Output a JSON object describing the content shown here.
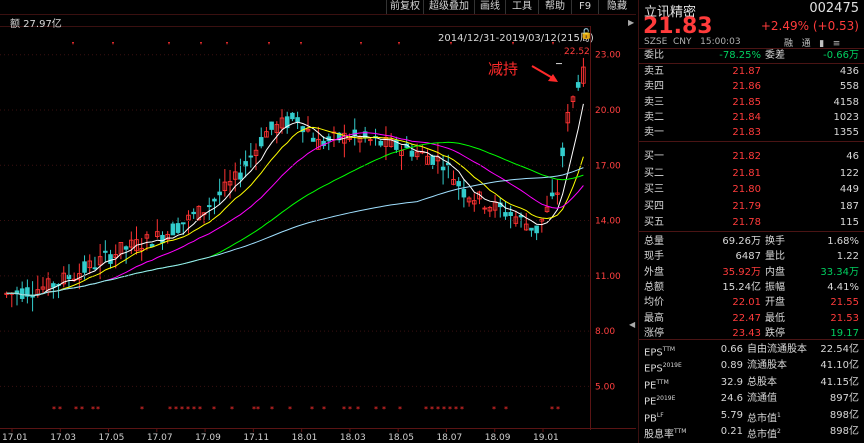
{
  "toolbar": {
    "items": [
      "前复权",
      "超级叠加",
      "画线",
      "工具",
      "帮助",
      "F9",
      "隐藏"
    ]
  },
  "chart": {
    "volume_label": "额 27.97亿",
    "range_label": "2014/12/31-2019/03/12(215周)",
    "annotation": "减持",
    "max_price_label": "22.52",
    "y_ticks": [
      "23.00",
      "20.00",
      "17.00",
      "14.00",
      "11.00",
      "8.00",
      "5.00"
    ],
    "x_ticks": [
      "17.01",
      "17.03",
      "17.05",
      "17.07",
      "17.09",
      "17.11",
      "18.01",
      "18.03",
      "18.05",
      "18.07",
      "18.09",
      "19.01"
    ],
    "arrow_left": "◀",
    "arrow_right": "▶",
    "colors": {
      "up": "#ff3333",
      "down": "#33cccc",
      "ma5": "#ffffff",
      "ma10": "#ffff00",
      "ma20": "#ff00ff",
      "ma60": "#00ff00",
      "ma120": "#a0e0ff"
    }
  },
  "chart_data": {
    "type": "candlestick",
    "ylim": [
      3.5,
      23.8
    ],
    "x_start": "2016-12",
    "x_end": "2019-03",
    "ma_levels": [
      "MA5",
      "MA10",
      "MA20",
      "MA60",
      "MA120"
    ]
  },
  "panel": {
    "stock_name": "立讯精密",
    "stock_code": "002475",
    "price": "21.83",
    "change": "+2.49% (+0.53)",
    "market": "SZSE",
    "currency": "CNY",
    "time": "15:00:03",
    "icons": [
      "融",
      "通",
      "▮",
      "≡"
    ],
    "weibi": {
      "label": "委比",
      "value": "-78.25%",
      "wc_label": "委差",
      "wc_value": "-0.66万"
    },
    "asks": [
      {
        "label": "卖五",
        "price": "21.87",
        "vol": "436"
      },
      {
        "label": "卖四",
        "price": "21.86",
        "vol": "558"
      },
      {
        "label": "卖三",
        "price": "21.85",
        "vol": "4158"
      },
      {
        "label": "卖二",
        "price": "21.84",
        "vol": "1023"
      },
      {
        "label": "卖一",
        "price": "21.83",
        "vol": "1355"
      }
    ],
    "bids": [
      {
        "label": "买一",
        "price": "21.82",
        "vol": "46"
      },
      {
        "label": "买二",
        "price": "21.81",
        "vol": "122"
      },
      {
        "label": "买三",
        "price": "21.80",
        "vol": "449"
      },
      {
        "label": "买四",
        "price": "21.79",
        "vol": "187"
      },
      {
        "label": "买五",
        "price": "21.78",
        "vol": "115"
      }
    ],
    "stats": [
      {
        "l1": "总量",
        "v1": "69.26万",
        "c1": "w",
        "l2": "换手",
        "v2": "1.68%",
        "c2": "w"
      },
      {
        "l1": "现手",
        "v1": "6487",
        "c1": "w",
        "l2": "量比",
        "v2": "1.22",
        "c2": "w"
      },
      {
        "l1": "外盘",
        "v1": "35.92万",
        "c1": "r",
        "l2": "内盘",
        "v2": "33.34万",
        "c2": "g"
      },
      {
        "l1": "总额",
        "v1": "15.24亿",
        "c1": "w",
        "l2": "振幅",
        "v2": "4.41%",
        "c2": "w"
      },
      {
        "l1": "均价",
        "v1": "22.01",
        "c1": "r",
        "l2": "开盘",
        "v2": "21.55",
        "c2": "r"
      },
      {
        "l1": "最高",
        "v1": "22.47",
        "c1": "r",
        "l2": "最低",
        "v2": "21.53",
        "c2": "r"
      },
      {
        "l1": "涨停",
        "v1": "23.43",
        "c1": "r",
        "l2": "跌停",
        "v2": "19.17",
        "c2": "g"
      }
    ],
    "fin": [
      {
        "l1": "EPS",
        "s1": "TTM",
        "v1": "0.66",
        "l2": "自由流通股本",
        "s2": "",
        "v2": "22.54亿"
      },
      {
        "l1": "EPS",
        "s1": "2019E",
        "v1": "0.89",
        "l2": "流通股本",
        "s2": "",
        "v2": "41.10亿"
      },
      {
        "l1": "PE",
        "s1": "TTM",
        "v1": "32.9",
        "l2": "总股本",
        "s2": "",
        "v2": "41.15亿"
      },
      {
        "l1": "PE",
        "s1": "2019E",
        "v1": "24.6",
        "l2": "流通值",
        "s2": "",
        "v2": "897亿"
      },
      {
        "l1": "PB",
        "s1": "LF",
        "v1": "5.79",
        "l2": "总市值",
        "s2": "1",
        "v2": "898亿"
      },
      {
        "l1": "股息率",
        "s1": "TTM",
        "v1": "0.21",
        "l2": "总市值",
        "s2": "2",
        "v2": "898亿"
      }
    ]
  }
}
